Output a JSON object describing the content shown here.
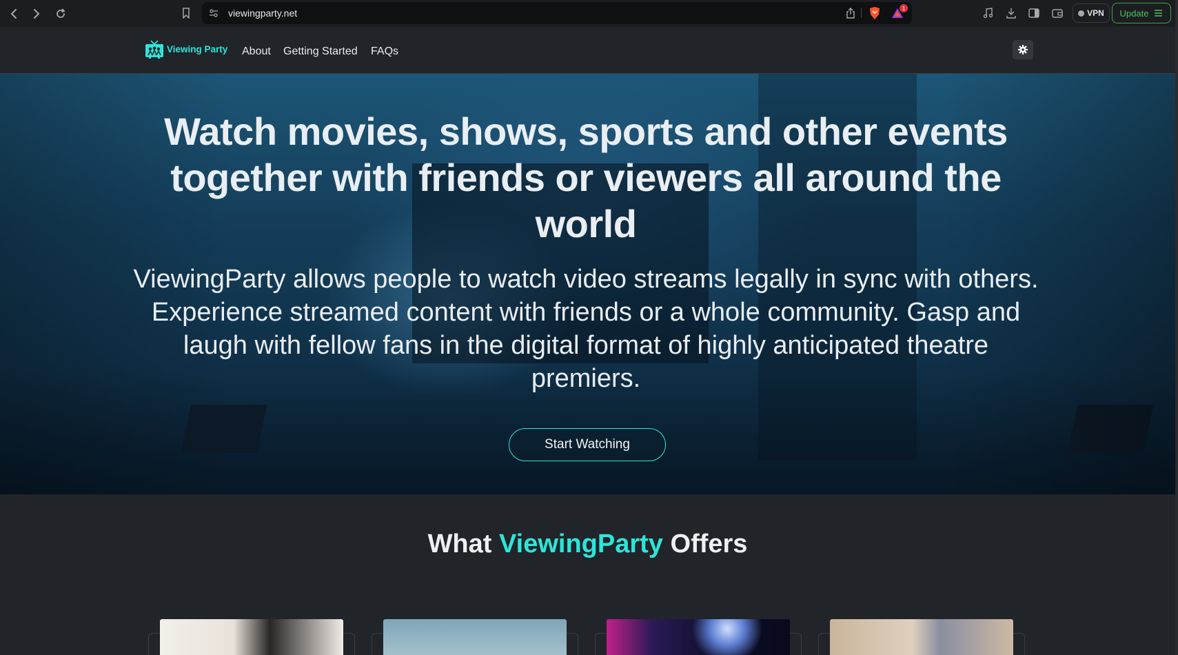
{
  "browser": {
    "url": "viewingparty.net",
    "vpn_label": "VPN",
    "update_label": "Update",
    "notification_count": "1"
  },
  "site": {
    "logo_text": "Viewing Party",
    "nav": [
      "About",
      "Getting Started",
      "FAQs"
    ]
  },
  "hero": {
    "title": "Watch movies, shows, sports and other events together with friends or viewers all around the world",
    "subtitle": "ViewingParty allows people to watch video streams legally in sync with others. Experience streamed content with friends or a whole community. Gasp and laugh with fellow fans in the digital format of highly anticipated theatre premiers.",
    "cta_label": "Start Watching"
  },
  "offers": {
    "title_prefix": "What ",
    "title_accent": "ViewingParty",
    "title_suffix": " Offers"
  },
  "colors": {
    "accent": "#2ee5d9",
    "update_green": "#50c25d",
    "brave_orange": "#fb542b"
  }
}
